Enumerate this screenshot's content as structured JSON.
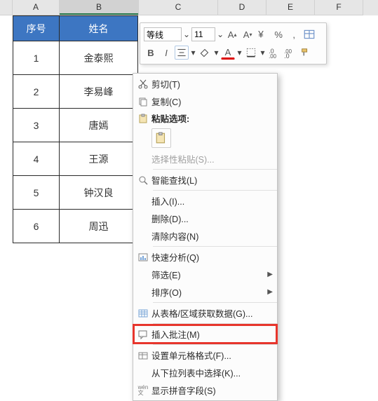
{
  "columns": {
    "A": "A",
    "B": "B",
    "C": "C",
    "D": "D",
    "E": "E",
    "F": "F"
  },
  "table": {
    "headers": {
      "seq": "序号",
      "name": "姓名"
    },
    "rows": [
      {
        "seq": "1",
        "name": "金泰熙"
      },
      {
        "seq": "2",
        "name": "李易峰"
      },
      {
        "seq": "3",
        "name": "唐嫣"
      },
      {
        "seq": "4",
        "name": "王源"
      },
      {
        "seq": "5",
        "name": "钟汉良"
      },
      {
        "seq": "6",
        "name": "周迅"
      }
    ]
  },
  "minitoolbar": {
    "font_name": "等线",
    "font_size": "11",
    "bold": "B",
    "italic": "I",
    "fontcolor_letter": "A",
    "highlight_letter": "A",
    "percent": "%",
    "comma": ","
  },
  "context_menu": {
    "cut": "剪切(T)",
    "copy": "复制(C)",
    "paste_opts_header": "粘贴选项:",
    "paste_special": "选择性粘贴(S)...",
    "smart_lookup": "智能查找(L)",
    "insert": "插入(I)...",
    "delete": "删除(D)...",
    "clear": "清除内容(N)",
    "quick_analysis": "快速分析(Q)",
    "filter": "筛选(E)",
    "sort": "排序(O)",
    "get_data": "从表格/区域获取数据(G)...",
    "insert_comment": "插入批注(M)",
    "format_cells": "设置单元格格式(F)...",
    "pick_list": "从下拉列表中选择(K)...",
    "show_pinyin": "显示拼音字段(S)"
  }
}
